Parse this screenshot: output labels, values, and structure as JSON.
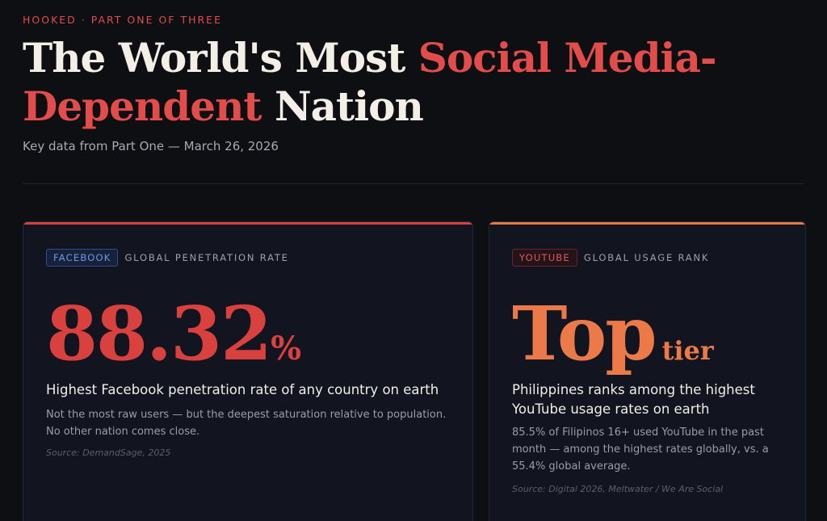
{
  "header": {
    "kicker": "HOOKED · PART ONE OF THREE",
    "title_part1": "The World's Most ",
    "title_accent1": "Social Media-",
    "title_accent2": "Dependent",
    "title_part2": " Nation",
    "subtitle": "Key data from Part One — March 26, 2026"
  },
  "colors": {
    "accent_red": "#e24c4b",
    "accent_orange": "#ec7a48",
    "facebook_blue": "#6b98e8",
    "background": "#0e0f12"
  },
  "cards": [
    {
      "tag": "FACEBOOK",
      "tag_desc": "GLOBAL PENETRATION RATE",
      "stat_main": "88.32",
      "stat_suffix": "%",
      "headline": "Highest Facebook penetration rate of any country on earth",
      "body": "Not the most raw users — but the deepest saturation relative to population. No other nation comes close.",
      "source": "Source: DemandSage, 2025"
    },
    {
      "tag": "YOUTUBE",
      "tag_desc": "GLOBAL USAGE RANK",
      "stat_main": "Top",
      "stat_suffix": "tier",
      "headline": "Philippines ranks among the highest YouTube usage rates on earth",
      "body": "85.5% of Filipinos 16+ used YouTube in the past month — among the highest rates globally, vs. a 55.4% global average.",
      "source": "Source: Digital 2026, Meltwater / We Are Social"
    }
  ]
}
